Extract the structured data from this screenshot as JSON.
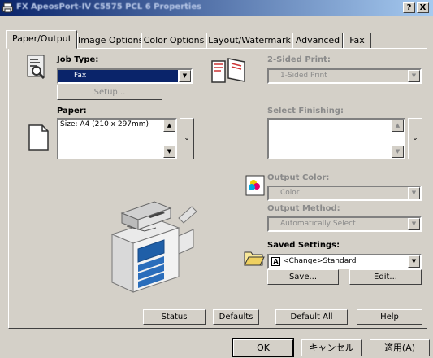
{
  "window": {
    "title": "FX ApeosPort-IV C5575 PCL 6 Properties",
    "help_label": "?",
    "close_label": "X"
  },
  "tabs": [
    {
      "label": "Paper/Output"
    },
    {
      "label": "Image Options"
    },
    {
      "label": "Color Options"
    },
    {
      "label": "Layout/Watermark"
    },
    {
      "label": "Advanced"
    },
    {
      "label": "Fax"
    }
  ],
  "job_type": {
    "label": "Job Type:",
    "value": "Fax",
    "setup_label": "Setup..."
  },
  "paper": {
    "label": "Paper:",
    "value": "Size: A4 (210 x 297mm)"
  },
  "two_sided": {
    "label": "2-Sided Print:",
    "value": "1-Sided Print"
  },
  "finishing": {
    "label": "Select Finishing:"
  },
  "output_color": {
    "label": "Output Color:",
    "value": "Color"
  },
  "output_method": {
    "label": "Output Method:",
    "value": "Automatically Select"
  },
  "saved_settings": {
    "label": "Saved Settings:",
    "value": "<Change>Standard",
    "save_label": "Save...",
    "edit_label": "Edit..."
  },
  "footer_buttons": {
    "status": "Status",
    "defaults": "Defaults",
    "default_all": "Default All",
    "help": "Help"
  },
  "dialog_buttons": {
    "ok": "OK",
    "cancel": "キャンセル",
    "apply": "適用(A)"
  },
  "colors": {
    "selection": "#0a246a",
    "face": "#d4d0c8",
    "disabled_text": "#8a8a8a"
  }
}
